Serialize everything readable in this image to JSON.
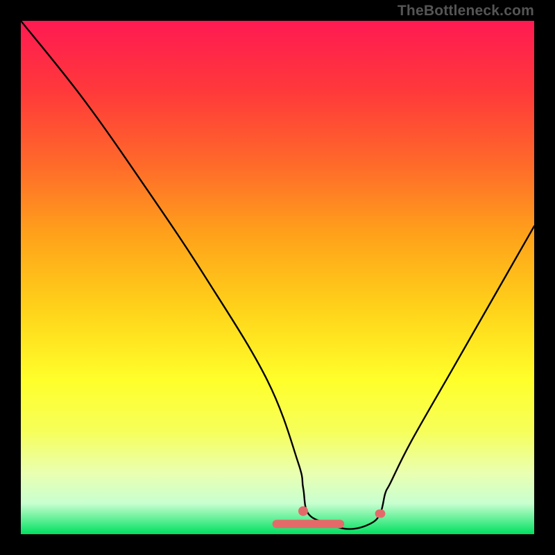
{
  "watermark": {
    "text": "TheBottleneck.com"
  },
  "chart_data": {
    "type": "line",
    "title": "",
    "xlabel": "",
    "ylabel": "",
    "xlim": [
      0,
      100
    ],
    "ylim": [
      0,
      100
    ],
    "series": [
      {
        "name": "curve",
        "x": [
          0,
          12,
          24,
          36,
          48,
          54,
          55,
          56,
          60,
          64,
          68,
          70,
          71,
          72,
          76,
          84,
          92,
          100
        ],
        "values": [
          100,
          85,
          68,
          50,
          30,
          14,
          9,
          4,
          2,
          1,
          2,
          4,
          8,
          10,
          18,
          32,
          46,
          60
        ]
      }
    ],
    "markers": [
      {
        "name": "marker-dot",
        "x": 55,
        "y": 4.5,
        "color": "#e46a6a"
      },
      {
        "name": "marker-bar-left",
        "x": 56,
        "y": 2.0,
        "w": 14,
        "color": "#e46a6a"
      },
      {
        "name": "marker-bar-right",
        "x": 70,
        "y": 4.0,
        "w": 2,
        "color": "#e46a6a"
      }
    ],
    "colors": {
      "curve": "#000000",
      "marker": "#e46a6a",
      "frame_bg": "#000000"
    }
  }
}
